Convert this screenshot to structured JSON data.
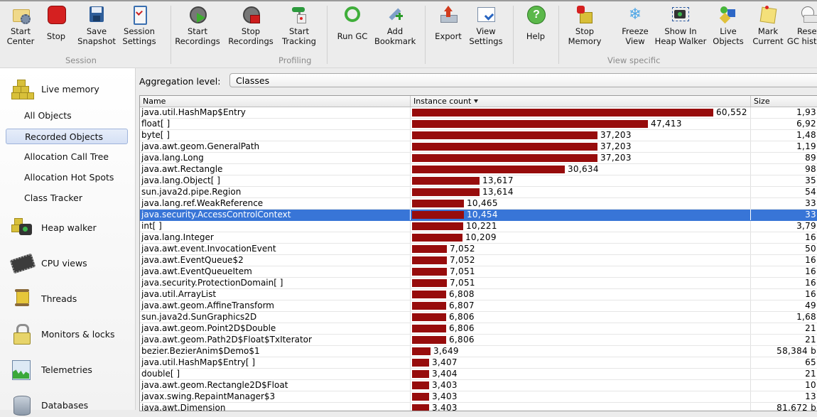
{
  "toolbar": {
    "buttons": [
      {
        "id": "start-center",
        "label": "Start\nCenter",
        "icon": "folder-gear-icon"
      },
      {
        "id": "stop",
        "label": "Stop",
        "icon": "stop-sign-icon"
      },
      {
        "id": "save-snapshot",
        "label": "Save\nSnapshot",
        "icon": "floppy-disk-icon"
      },
      {
        "id": "session-settings",
        "label": "Session\nSettings",
        "icon": "clipboard-check-icon"
      },
      {
        "id": "start-recordings",
        "label": "Start\nRecordings",
        "icon": "film-reel-play-icon"
      },
      {
        "id": "stop-recordings",
        "label": "Stop\nRecordings",
        "icon": "film-reel-stop-icon"
      },
      {
        "id": "start-tracking",
        "label": "Start\nTracking",
        "icon": "signpost-icon"
      },
      {
        "id": "run-gc",
        "label": "Run GC",
        "icon": "recycle-icon"
      },
      {
        "id": "add-bookmark",
        "label": "Add\nBookmark",
        "icon": "bookmark-add-icon"
      },
      {
        "id": "export",
        "label": "Export",
        "icon": "export-arrow-icon"
      },
      {
        "id": "view-settings",
        "label": "View\nSettings",
        "icon": "window-check-icon"
      },
      {
        "id": "help",
        "label": "Help",
        "icon": "help-icon"
      },
      {
        "id": "stop-memory",
        "label": "Stop\nMemory",
        "icon": "memory-stop-icon"
      },
      {
        "id": "freeze-view",
        "label": "Freeze\nView",
        "icon": "snowflake-icon"
      },
      {
        "id": "show-in-heap-walker",
        "label": "Show In\nHeap Walker",
        "icon": "camera-icon"
      },
      {
        "id": "live-objects",
        "label": "Live\nObjects",
        "icon": "shapes-icon"
      },
      {
        "id": "mark-current",
        "label": "Mark\nCurrent",
        "icon": "note-pin-icon"
      },
      {
        "id": "reset-gc-history",
        "label": "Reset\nGC history",
        "icon": "reset-clock-icon"
      }
    ],
    "groups": [
      {
        "label": "Session"
      },
      {
        "label": "Profiling"
      },
      {
        "label": "View specific"
      }
    ]
  },
  "sidebar": {
    "categories": [
      {
        "label": "Live memory",
        "icon": "gold-blocks-icon"
      },
      {
        "label": "Heap walker",
        "icon": "heap-camera-icon"
      },
      {
        "label": "CPU views",
        "icon": "cpu-chip-icon"
      },
      {
        "label": "Threads",
        "icon": "thread-spool-icon"
      },
      {
        "label": "Monitors & locks",
        "icon": "padlock-icon"
      },
      {
        "label": "Telemetries",
        "icon": "telemetry-graph-icon"
      },
      {
        "label": "Databases",
        "icon": "database-icon"
      }
    ],
    "live_memory_items": [
      {
        "label": "All Objects",
        "selected": false
      },
      {
        "label": "Recorded Objects",
        "selected": true
      },
      {
        "label": "Allocation Call Tree",
        "selected": false
      },
      {
        "label": "Allocation Hot Spots",
        "selected": false
      },
      {
        "label": "Class Tracker",
        "selected": false
      }
    ]
  },
  "main": {
    "aggregation_label": "Aggregation level:",
    "aggregation_value": "Classes",
    "columns": [
      "Name",
      "Instance count",
      "Size"
    ],
    "sort_column": "Instance count",
    "sort_direction": "descending",
    "selected_row": 9,
    "rows": [
      {
        "name": "java.util.HashMap$Entry",
        "count": 60552,
        "count_label": "60,552",
        "size": "1,93"
      },
      {
        "name": "float[ ]",
        "count": 47413,
        "count_label": "47,413",
        "size": "6,92"
      },
      {
        "name": "byte[ ]",
        "count": 37203,
        "count_label": "37,203",
        "size": "1,48"
      },
      {
        "name": "java.awt.geom.GeneralPath",
        "count": 37203,
        "count_label": "37,203",
        "size": "1,19"
      },
      {
        "name": "java.lang.Long",
        "count": 37203,
        "count_label": "37,203",
        "size": "89"
      },
      {
        "name": "java.awt.Rectangle",
        "count": 30634,
        "count_label": "30,634",
        "size": "98"
      },
      {
        "name": "java.lang.Object[ ]",
        "count": 13617,
        "count_label": "13,617",
        "size": "35"
      },
      {
        "name": "sun.java2d.pipe.Region",
        "count": 13614,
        "count_label": "13,614",
        "size": "54"
      },
      {
        "name": "java.lang.ref.WeakReference",
        "count": 10465,
        "count_label": "10,465",
        "size": "33"
      },
      {
        "name": "java.security.AccessControlContext",
        "count": 10454,
        "count_label": "10,454",
        "size": "33"
      },
      {
        "name": "int[ ]",
        "count": 10221,
        "count_label": "10,221",
        "size": "3,79"
      },
      {
        "name": "java.lang.Integer",
        "count": 10209,
        "count_label": "10,209",
        "size": "16"
      },
      {
        "name": "java.awt.event.InvocationEvent",
        "count": 7052,
        "count_label": "7,052",
        "size": "50"
      },
      {
        "name": "java.awt.EventQueue$2",
        "count": 7052,
        "count_label": "7,052",
        "size": "16"
      },
      {
        "name": "java.awt.EventQueueItem",
        "count": 7051,
        "count_label": "7,051",
        "size": "16"
      },
      {
        "name": "java.security.ProtectionDomain[ ]",
        "count": 7051,
        "count_label": "7,051",
        "size": "16"
      },
      {
        "name": "java.util.ArrayList",
        "count": 6808,
        "count_label": "6,808",
        "size": "16"
      },
      {
        "name": "java.awt.geom.AffineTransform",
        "count": 6807,
        "count_label": "6,807",
        "size": "49"
      },
      {
        "name": "sun.java2d.SunGraphics2D",
        "count": 6806,
        "count_label": "6,806",
        "size": "1,68"
      },
      {
        "name": "java.awt.geom.Point2D$Double",
        "count": 6806,
        "count_label": "6,806",
        "size": "21"
      },
      {
        "name": "java.awt.geom.Path2D$Float$TxIterator",
        "count": 6806,
        "count_label": "6,806",
        "size": "21"
      },
      {
        "name": "bezier.BezierAnim$Demo$1",
        "count": 3649,
        "count_label": "3,649",
        "size": "58,384 b"
      },
      {
        "name": "java.util.HashMap$Entry[ ]",
        "count": 3407,
        "count_label": "3,407",
        "size": "65"
      },
      {
        "name": "double[ ]",
        "count": 3404,
        "count_label": "3,404",
        "size": "21"
      },
      {
        "name": "java.awt.geom.Rectangle2D$Float",
        "count": 3403,
        "count_label": "3,403",
        "size": "10"
      },
      {
        "name": "javax.swing.RepaintManager$3",
        "count": 3403,
        "count_label": "3,403",
        "size": "13"
      },
      {
        "name": "java.awt.Dimension",
        "count": 3403,
        "count_label": "3,403",
        "size": "81,672 b"
      }
    ]
  },
  "colors": {
    "bar": "#970c0c",
    "selection": "#3875d7",
    "sidebar_selection": "#d5e0f5"
  }
}
